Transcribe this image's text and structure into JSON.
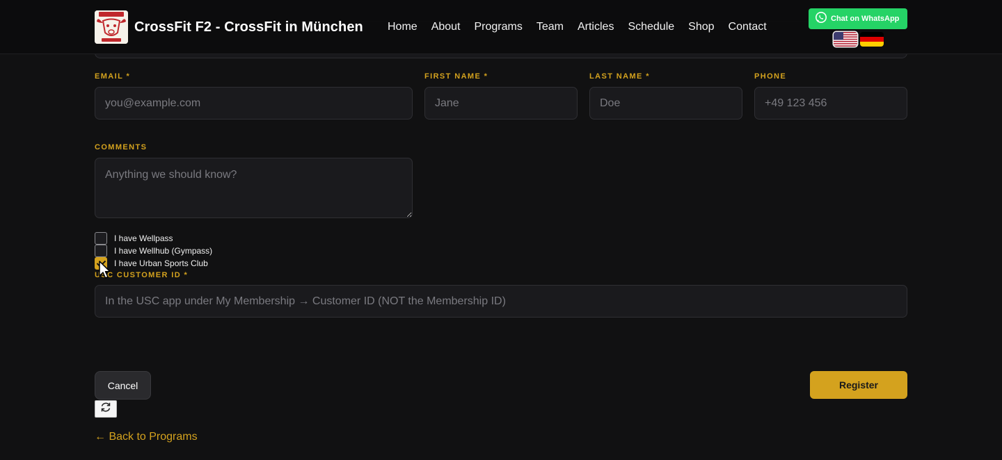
{
  "header": {
    "brand": "CrossFit F2 - CrossFit in München",
    "logo_icon": "crossfit-f2-bull-logo",
    "nav": [
      "Home",
      "About",
      "Programs",
      "Team",
      "Articles",
      "Schedule",
      "Shop",
      "Contact"
    ],
    "whatsapp_label": "Chat on WhatsApp",
    "languages": [
      "en-us-flag-icon",
      "de-flag-icon"
    ]
  },
  "form": {
    "email": {
      "label": "EMAIL *",
      "placeholder": "you@example.com",
      "value": ""
    },
    "first_name": {
      "label": "FIRST NAME *",
      "placeholder": "Jane",
      "value": ""
    },
    "last_name": {
      "label": "LAST NAME *",
      "placeholder": "Doe",
      "value": ""
    },
    "phone": {
      "label": "PHONE",
      "placeholder": "+49 123 456",
      "value": ""
    },
    "comments": {
      "label": "COMMENTS",
      "placeholder": "Anything we should know?",
      "value": ""
    },
    "checkboxes": [
      {
        "label": "I have Wellpass",
        "checked": false
      },
      {
        "label": "I have Wellhub (Gympass)",
        "checked": false
      },
      {
        "label": "I have Urban Sports Club",
        "checked": true
      }
    ],
    "usc": {
      "label": "USC CUSTOMER ID *",
      "placeholder": "In the USC app under My Membership → Customer ID (NOT the Membership ID)",
      "value": ""
    }
  },
  "actions": {
    "cancel": "Cancel",
    "register": "Register",
    "refresh_icon": "refresh-icon",
    "back": "← Back to Programs"
  },
  "colors": {
    "accent": "#d4a21e",
    "background": "#111112",
    "whatsapp": "#25d366"
  }
}
